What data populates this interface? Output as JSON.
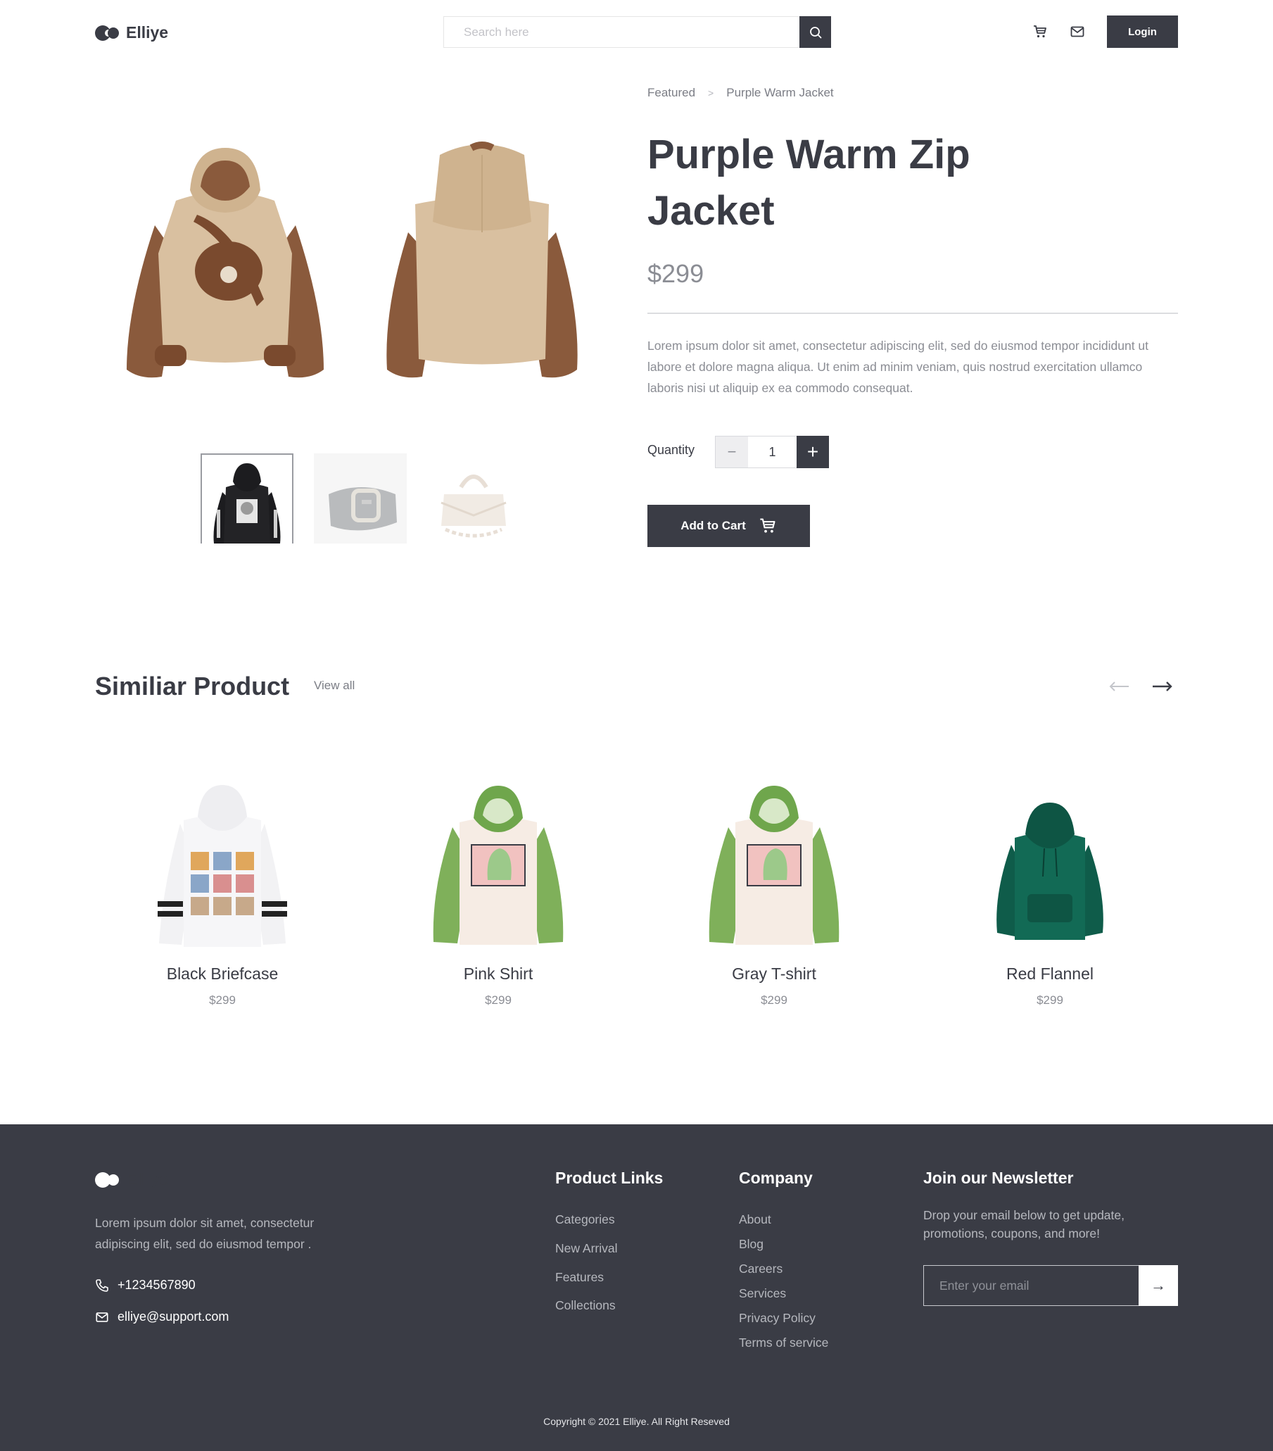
{
  "brand": {
    "name": "Elliye"
  },
  "header": {
    "search_placeholder": "Search here",
    "login_label": "Login",
    "icons": [
      "cart-icon",
      "mail-icon",
      "search-icon"
    ]
  },
  "breadcrumb": [
    "Featured",
    "Purple Warm Jacket"
  ],
  "product": {
    "title": "Purple Warm Zip Jacket",
    "price": "$299",
    "description": "Lorem ipsum dolor sit amet, consectetur adipiscing elit, sed do eiusmod tempor incididunt ut labore et dolore magna aliqua. Ut enim ad minim veniam, quis nostrud exercitation ullamco laboris nisi ut aliquip ex ea commodo consequat.",
    "quantity_label": "Quantity",
    "quantity": "1",
    "minus": "−",
    "plus": "+",
    "add_to_cart": "Add to Cart"
  },
  "similar": {
    "title": "Similiar Product",
    "view_all": "View all",
    "items": [
      {
        "name": "Black Briefcase",
        "price": "$299"
      },
      {
        "name": "Pink Shirt",
        "price": "$299"
      },
      {
        "name": "Gray T-shirt",
        "price": "$299"
      },
      {
        "name": "Red Flannel",
        "price": "$299"
      }
    ]
  },
  "footer": {
    "brand": "Elliye",
    "description": "Lorem ipsum dolor sit amet, consectetur adipiscing elit, sed do eiusmod tempor .",
    "phone": "+1234567890",
    "email": "elliye@support.com",
    "product_links": {
      "title": "Product Links",
      "items": [
        "Categories",
        "New Arrival",
        "Features",
        "Collections"
      ]
    },
    "company": {
      "title": "Company",
      "items": [
        "About",
        "Blog",
        "Careers",
        "Services",
        "Privacy Policy",
        "Terms of service"
      ]
    },
    "newsletter": {
      "title": "Join our Newsletter",
      "text": "Drop your email below to get update, promotions, coupons, and more!",
      "placeholder": "Enter your email",
      "submit": "→"
    },
    "copyright": "Copyright © 2021 Elliye. All Right Reseved"
  },
  "colors": {
    "primary": "#3a3c45",
    "muted": "#8b8d94",
    "footer_text": "#b6b8be"
  }
}
